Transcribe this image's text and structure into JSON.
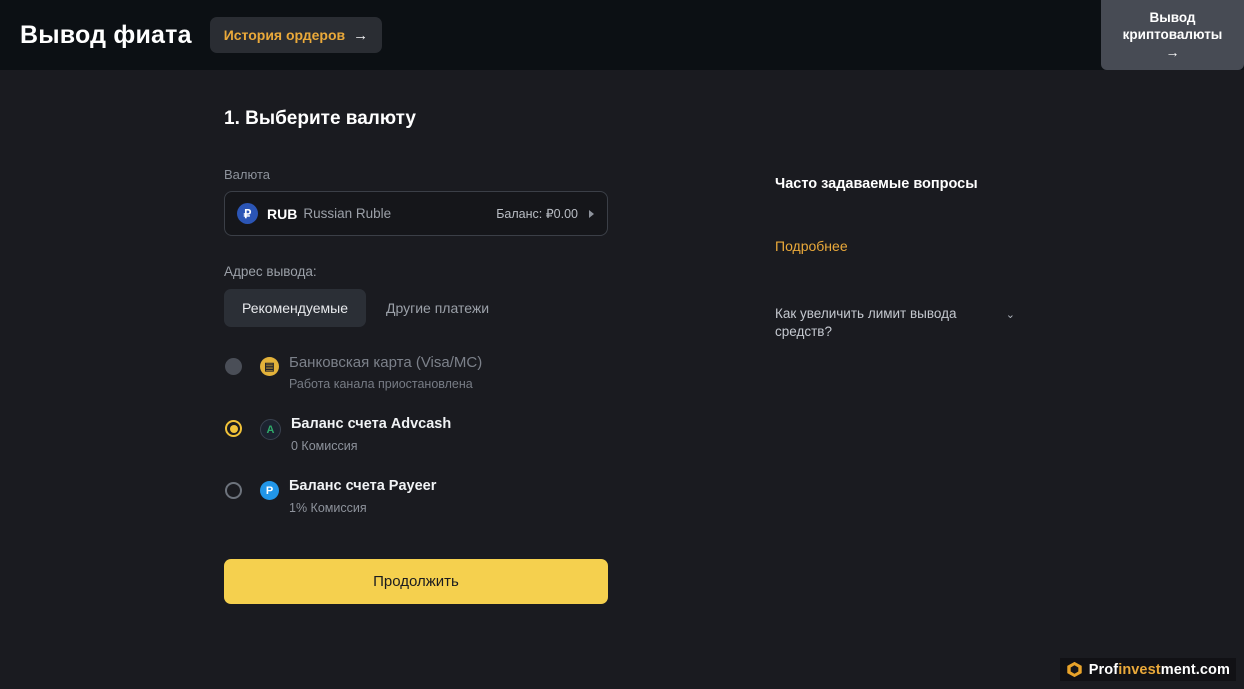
{
  "header": {
    "title": "Вывод фиата",
    "orders_history_label": "История ордеров",
    "orders_history_arrow": "→",
    "crypto_withdraw_line1": "Вывод",
    "crypto_withdraw_line2": "криптовалюты",
    "crypto_withdraw_arrow": "→"
  },
  "main": {
    "step_title": "1. Выберите валюту",
    "currency_label": "Валюта",
    "currency": {
      "badge": "₽",
      "code": "RUB",
      "name": "Russian Ruble",
      "balance_label": "Баланс:",
      "balance_value": "₽0.00",
      "chevron_icon": "chevron-right-icon"
    },
    "withdraw_address_label": "Адрес вывода:",
    "tabs": [
      {
        "label": "Рекомендуемые",
        "active": true
      },
      {
        "label": "Другие платежи",
        "active": false
      }
    ],
    "options": [
      {
        "title": "Банковская карта (Visa/MC)",
        "subtitle": "Работа канала приостановлена",
        "icon_glyph": "▤",
        "icon_name": "bank-card-icon",
        "state": "disabled"
      },
      {
        "title": "Баланс счета Advcash",
        "subtitle": "0 Комиссия",
        "icon_glyph": "A",
        "icon_name": "advcash-icon",
        "state": "selected"
      },
      {
        "title": "Баланс счета Payeer",
        "subtitle": "1% Комиссия",
        "icon_glyph": "P",
        "icon_name": "payeer-icon",
        "state": "unselected"
      }
    ],
    "continue_label": "Продолжить"
  },
  "faq": {
    "title": "Часто задаваемые вопросы",
    "more_label": "Подробнее",
    "items": [
      {
        "question": "Как увеличить лимит вывода средств?",
        "chevron": "⌄"
      }
    ]
  },
  "watermark": {
    "part1": "Prof",
    "part2": "invest",
    "part3": "ment.com"
  },
  "colors": {
    "accent_gold": "#eaa93a",
    "button_yellow": "#f5d04e",
    "header_bg": "#0c1014",
    "page_bg": "#1a1b20"
  }
}
